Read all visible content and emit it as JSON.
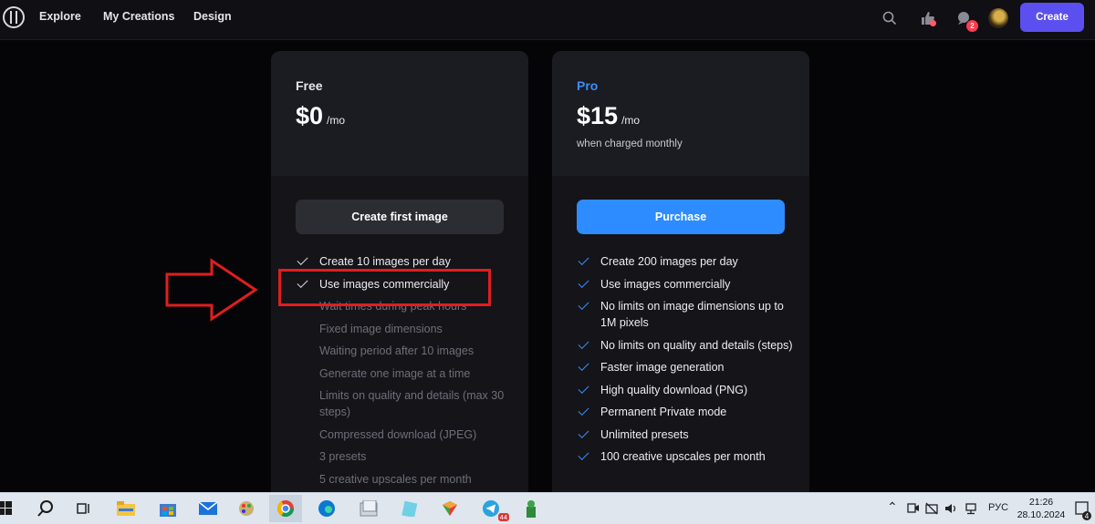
{
  "nav": {
    "items": [
      "Explore",
      "My Creations",
      "Design"
    ],
    "create_label": "Create",
    "notifications_count": "2"
  },
  "plans": {
    "free": {
      "name": "Free",
      "price": "$0",
      "period": "/mo",
      "action_label": "Create first image",
      "features": [
        {
          "text": "Create 10 images per day",
          "included": true
        },
        {
          "text": "Use images commercially",
          "included": true
        },
        {
          "text": "Wait times during peak hours",
          "included": false
        },
        {
          "text": "Fixed image dimensions",
          "included": false
        },
        {
          "text": "Waiting period after 10 images",
          "included": false
        },
        {
          "text": "Generate one image at a time",
          "included": false
        },
        {
          "text": "Limits on quality and details (max 30 steps)",
          "included": false
        },
        {
          "text": "Compressed download (JPEG)",
          "included": false
        },
        {
          "text": "3 presets",
          "included": false
        },
        {
          "text": "5 creative upscales per month",
          "included": false
        }
      ]
    },
    "pro": {
      "name": "Pro",
      "price": "$15",
      "period": "/mo",
      "subtitle": "when charged monthly",
      "action_label": "Purchase",
      "features": [
        {
          "text": "Create 200 images per day",
          "included": true
        },
        {
          "text": "Use images commercially",
          "included": true
        },
        {
          "text": "No limits on image dimensions up to 1M pixels",
          "included": true
        },
        {
          "text": "No limits on quality and details (steps)",
          "included": true
        },
        {
          "text": "Faster image generation",
          "included": true
        },
        {
          "text": "High quality download (PNG)",
          "included": true
        },
        {
          "text": "Permanent Private mode",
          "included": true
        },
        {
          "text": "Unlimited presets",
          "included": true
        },
        {
          "text": "100 creative upscales per month",
          "included": true
        }
      ]
    }
  },
  "taskbar": {
    "language": "РУС",
    "time": "21:26",
    "date": "28.10.2024",
    "telegram_badge": "44",
    "notification_count": "4"
  },
  "colors": {
    "accent": "#5b4ff0",
    "pro_blue": "#2d8cff",
    "highlight_red": "#e01e1e"
  }
}
